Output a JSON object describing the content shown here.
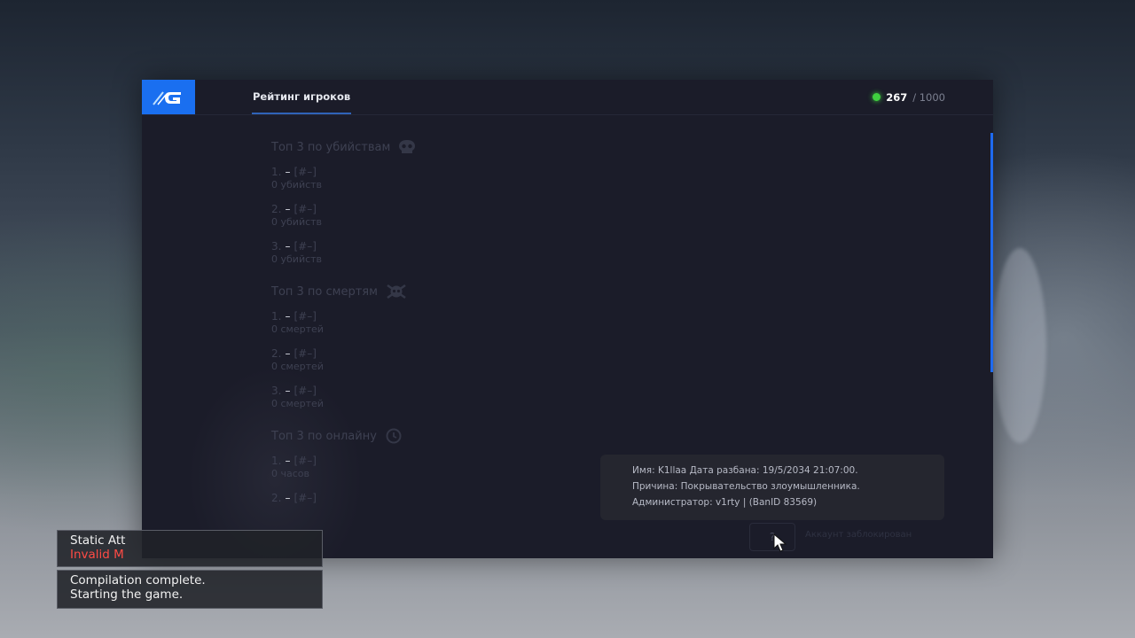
{
  "header": {
    "tab_label": "Рейтинг игроков",
    "online_current": "267",
    "online_max": "/ 1000"
  },
  "colors": {
    "accent": "#1a6ff0",
    "online_dot": "#3fcf3f",
    "error": "#ff4b45"
  },
  "sections": [
    {
      "title": "Топ 3 по убийствам",
      "icon": "skull-icon",
      "entries": [
        {
          "rank": "1.",
          "name": "–",
          "tag": "[#–]",
          "sub": "0 убийств"
        },
        {
          "rank": "2.",
          "name": "–",
          "tag": "[#–]",
          "sub": "0 убийств"
        },
        {
          "rank": "3.",
          "name": "–",
          "tag": "[#–]",
          "sub": "0 убийств"
        }
      ]
    },
    {
      "title": "Топ 3 по смертям",
      "icon": "crossbones-icon",
      "entries": [
        {
          "rank": "1.",
          "name": "–",
          "tag": "[#–]",
          "sub": "0 смертей"
        },
        {
          "rank": "2.",
          "name": "–",
          "tag": "[#–]",
          "sub": "0 смертей"
        },
        {
          "rank": "3.",
          "name": "–",
          "tag": "[#–]",
          "sub": "0 смертей"
        }
      ]
    },
    {
      "title": "Топ 3 по онлайну",
      "icon": "clock-icon",
      "entries": [
        {
          "rank": "1.",
          "name": "–",
          "tag": "[#–]",
          "sub": "0 часов"
        },
        {
          "rank": "2.",
          "name": "–",
          "tag": "[#–]",
          "sub": ""
        }
      ]
    }
  ],
  "ban": {
    "line1": "Имя: K1llaa Дата разбана: 19/5/2034 21:07:00.",
    "line2": "Причина: Покрывательство злоумышленника.",
    "line3": "Администратор: v1rty | (BanID 83569)",
    "help_symbol": "?",
    "locked_label": "Аккаунт заблокирован"
  },
  "console": {
    "line1": "Static Att",
    "line2": "Invalid M",
    "line3": "Compilation complete.",
    "line4": "Starting the game."
  }
}
